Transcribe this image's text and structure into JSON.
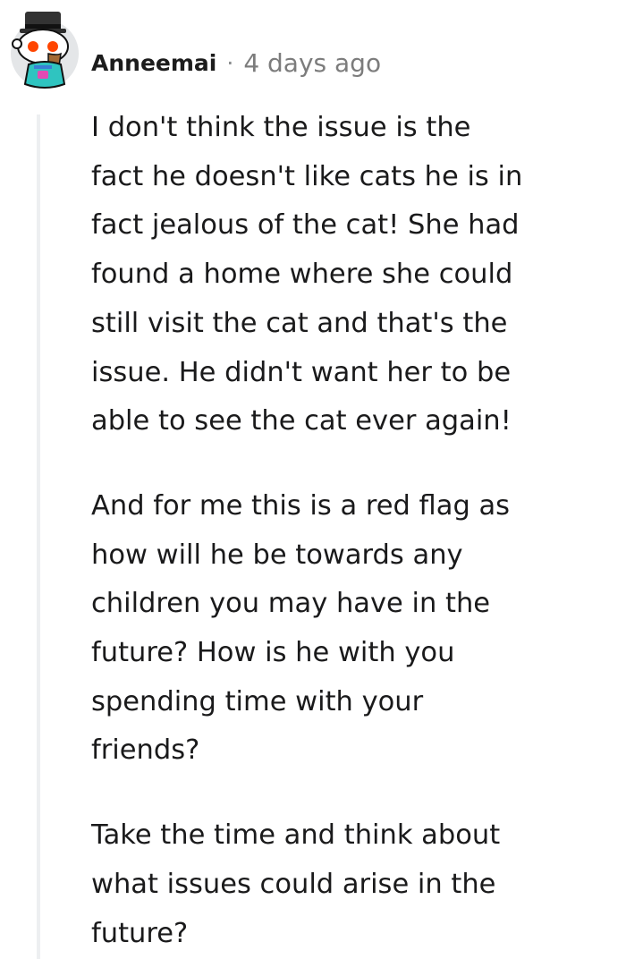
{
  "comment": {
    "author": "Anneemai",
    "separator": "·",
    "timestamp": "4 days ago",
    "avatar_icon": "snoo-avatar-with-hat-and-sunglasses-icon",
    "paragraphs": [
      "I don't think the issue is the\nfact he doesn't like cats he is in\nfact jealous of the cat! She had\nfound a home where she could\nstill visit the cat and that's the\nissue. He didn't want her to be\nable to see the cat ever again!",
      "And for me this is a red flag as\nhow will he be towards any\nchildren you may have in the\nfuture? How is he with you\nspending time with your\nfriends?",
      "Take the time and think about\nwhat issues could arise in the\nfuture?"
    ]
  },
  "colors": {
    "text": "#1a1a1b",
    "meta": "#7c7c7c",
    "thread_line": "#edeff1",
    "avatar_bg": "#e2e4e6",
    "accent": "#ff4500"
  }
}
